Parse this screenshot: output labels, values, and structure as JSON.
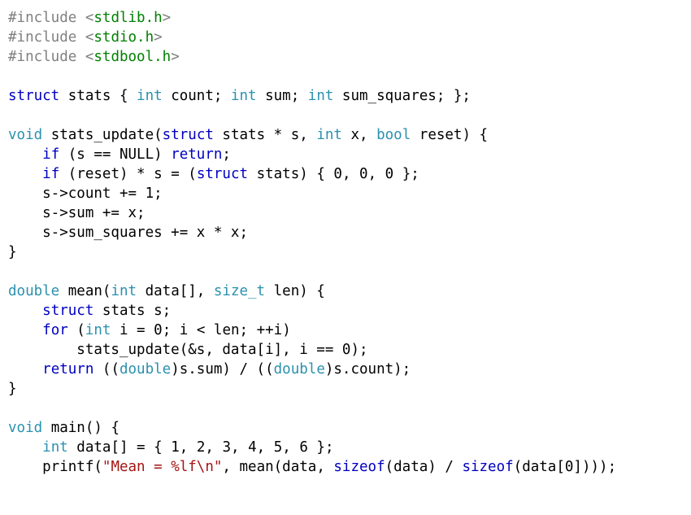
{
  "code": {
    "lines": [
      [
        {
          "t": "#include ",
          "c": "tok-pp"
        },
        {
          "t": "<",
          "c": "tok-pp"
        },
        {
          "t": "stdlib.h",
          "c": "tok-hdr"
        },
        {
          "t": ">",
          "c": "tok-pp"
        }
      ],
      [
        {
          "t": "#include ",
          "c": "tok-pp"
        },
        {
          "t": "<",
          "c": "tok-pp"
        },
        {
          "t": "stdio.h",
          "c": "tok-hdr"
        },
        {
          "t": ">",
          "c": "tok-pp"
        }
      ],
      [
        {
          "t": "#include ",
          "c": "tok-pp"
        },
        {
          "t": "<",
          "c": "tok-pp"
        },
        {
          "t": "stdbool.h",
          "c": "tok-hdr"
        },
        {
          "t": ">",
          "c": "tok-pp"
        }
      ],
      [],
      [
        {
          "t": "struct",
          "c": "tok-kw"
        },
        {
          "t": " stats { ",
          "c": "tok-id"
        },
        {
          "t": "int",
          "c": "tok-ty"
        },
        {
          "t": " count; ",
          "c": "tok-id"
        },
        {
          "t": "int",
          "c": "tok-ty"
        },
        {
          "t": " sum; ",
          "c": "tok-id"
        },
        {
          "t": "int",
          "c": "tok-ty"
        },
        {
          "t": " sum_squares; };",
          "c": "tok-id"
        }
      ],
      [],
      [
        {
          "t": "void",
          "c": "tok-ty"
        },
        {
          "t": " stats_update(",
          "c": "tok-id"
        },
        {
          "t": "struct",
          "c": "tok-kw"
        },
        {
          "t": " stats * s, ",
          "c": "tok-id"
        },
        {
          "t": "int",
          "c": "tok-ty"
        },
        {
          "t": " x, ",
          "c": "tok-id"
        },
        {
          "t": "bool",
          "c": "tok-ty"
        },
        {
          "t": " reset) {",
          "c": "tok-id"
        }
      ],
      [
        {
          "t": "    ",
          "c": "tok-id"
        },
        {
          "t": "if",
          "c": "tok-kw"
        },
        {
          "t": " (s == NULL) ",
          "c": "tok-id"
        },
        {
          "t": "return",
          "c": "tok-kw"
        },
        {
          "t": ";",
          "c": "tok-id"
        }
      ],
      [
        {
          "t": "    ",
          "c": "tok-id"
        },
        {
          "t": "if",
          "c": "tok-kw"
        },
        {
          "t": " (reset) * s = (",
          "c": "tok-id"
        },
        {
          "t": "struct",
          "c": "tok-kw"
        },
        {
          "t": " stats) { ",
          "c": "tok-id"
        },
        {
          "t": "0",
          "c": "tok-num"
        },
        {
          "t": ", ",
          "c": "tok-id"
        },
        {
          "t": "0",
          "c": "tok-num"
        },
        {
          "t": ", ",
          "c": "tok-id"
        },
        {
          "t": "0",
          "c": "tok-num"
        },
        {
          "t": " };",
          "c": "tok-id"
        }
      ],
      [
        {
          "t": "    s->count += ",
          "c": "tok-id"
        },
        {
          "t": "1",
          "c": "tok-num"
        },
        {
          "t": ";",
          "c": "tok-id"
        }
      ],
      [
        {
          "t": "    s->sum += x;",
          "c": "tok-id"
        }
      ],
      [
        {
          "t": "    s->sum_squares += x * x;",
          "c": "tok-id"
        }
      ],
      [
        {
          "t": "}",
          "c": "tok-id"
        }
      ],
      [],
      [
        {
          "t": "double",
          "c": "tok-ty"
        },
        {
          "t": " mean(",
          "c": "tok-id"
        },
        {
          "t": "int",
          "c": "tok-ty"
        },
        {
          "t": " data[], ",
          "c": "tok-id"
        },
        {
          "t": "size_t",
          "c": "tok-ty"
        },
        {
          "t": " len) {",
          "c": "tok-id"
        }
      ],
      [
        {
          "t": "    ",
          "c": "tok-id"
        },
        {
          "t": "struct",
          "c": "tok-kw"
        },
        {
          "t": " stats s;",
          "c": "tok-id"
        }
      ],
      [
        {
          "t": "    ",
          "c": "tok-id"
        },
        {
          "t": "for",
          "c": "tok-kw"
        },
        {
          "t": " (",
          "c": "tok-id"
        },
        {
          "t": "int",
          "c": "tok-ty"
        },
        {
          "t": " i = ",
          "c": "tok-id"
        },
        {
          "t": "0",
          "c": "tok-num"
        },
        {
          "t": "; i < len; ++i)",
          "c": "tok-id"
        }
      ],
      [
        {
          "t": "        stats_update(&s, data[i], i == ",
          "c": "tok-id"
        },
        {
          "t": "0",
          "c": "tok-num"
        },
        {
          "t": ");",
          "c": "tok-id"
        }
      ],
      [
        {
          "t": "    ",
          "c": "tok-id"
        },
        {
          "t": "return",
          "c": "tok-kw"
        },
        {
          "t": " ((",
          "c": "tok-id"
        },
        {
          "t": "double",
          "c": "tok-ty"
        },
        {
          "t": ")s.sum) / ((",
          "c": "tok-id"
        },
        {
          "t": "double",
          "c": "tok-ty"
        },
        {
          "t": ")s.count);",
          "c": "tok-id"
        }
      ],
      [
        {
          "t": "}",
          "c": "tok-id"
        }
      ],
      [],
      [
        {
          "t": "void",
          "c": "tok-ty"
        },
        {
          "t": " main() {",
          "c": "tok-id"
        }
      ],
      [
        {
          "t": "    ",
          "c": "tok-id"
        },
        {
          "t": "int",
          "c": "tok-ty"
        },
        {
          "t": " data[] = { ",
          "c": "tok-id"
        },
        {
          "t": "1",
          "c": "tok-num"
        },
        {
          "t": ", ",
          "c": "tok-id"
        },
        {
          "t": "2",
          "c": "tok-num"
        },
        {
          "t": ", ",
          "c": "tok-id"
        },
        {
          "t": "3",
          "c": "tok-num"
        },
        {
          "t": ", ",
          "c": "tok-id"
        },
        {
          "t": "4",
          "c": "tok-num"
        },
        {
          "t": ", ",
          "c": "tok-id"
        },
        {
          "t": "5",
          "c": "tok-num"
        },
        {
          "t": ", ",
          "c": "tok-id"
        },
        {
          "t": "6",
          "c": "tok-num"
        },
        {
          "t": " };",
          "c": "tok-id"
        }
      ],
      [
        {
          "t": "    printf(",
          "c": "tok-id"
        },
        {
          "t": "\"Mean = %lf\\n\"",
          "c": "tok-str"
        },
        {
          "t": ", mean(data, ",
          "c": "tok-id"
        },
        {
          "t": "sizeof",
          "c": "tok-kw"
        },
        {
          "t": "(data) / ",
          "c": "tok-id"
        },
        {
          "t": "sizeof",
          "c": "tok-kw"
        },
        {
          "t": "(data[",
          "c": "tok-id"
        },
        {
          "t": "0",
          "c": "tok-num"
        },
        {
          "t": "])));",
          "c": "tok-id"
        }
      ]
    ]
  }
}
